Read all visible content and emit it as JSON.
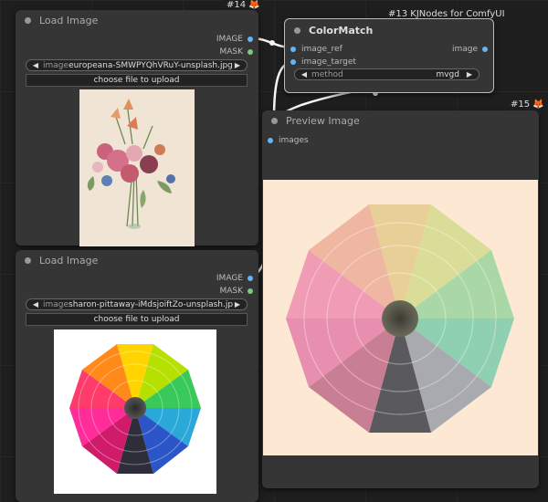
{
  "nodes": {
    "load1": {
      "id_badge": "#14",
      "title": "Load Image",
      "outputs": [
        "IMAGE",
        "MASK"
      ],
      "image_label": "image",
      "image_value": "europeana-SMWPYQhVRuY-unsplash.jpg",
      "upload_label": "choose file to upload"
    },
    "load2": {
      "title": "Load Image",
      "outputs": [
        "IMAGE",
        "MASK"
      ],
      "image_label": "image",
      "image_value": "sharon-pittaway-iMdsjoiftZo-unsplash.jpg",
      "upload_label": "choose file to upload"
    },
    "colormatch": {
      "id_badge": "#13 KJNodes for ComfyUI",
      "title": "ColorMatch",
      "inputs": [
        "image_ref",
        "image_target"
      ],
      "output": "image",
      "method_label": "method",
      "method_value": "mvgd"
    },
    "preview": {
      "id_badge": "#15",
      "title": "Preview Image",
      "input": "images"
    }
  },
  "colors": {
    "canvas": "#1e1e1e",
    "node_body": "#353535",
    "image_socket": "#64b5f6",
    "mask_socket": "#81c784",
    "badge_icon": "#e9772a",
    "preview_background": "#fde9d3"
  },
  "icons": {
    "badge": "fox-icon",
    "arrows": [
      "arrow-left-icon",
      "arrow-right-icon"
    ]
  }
}
